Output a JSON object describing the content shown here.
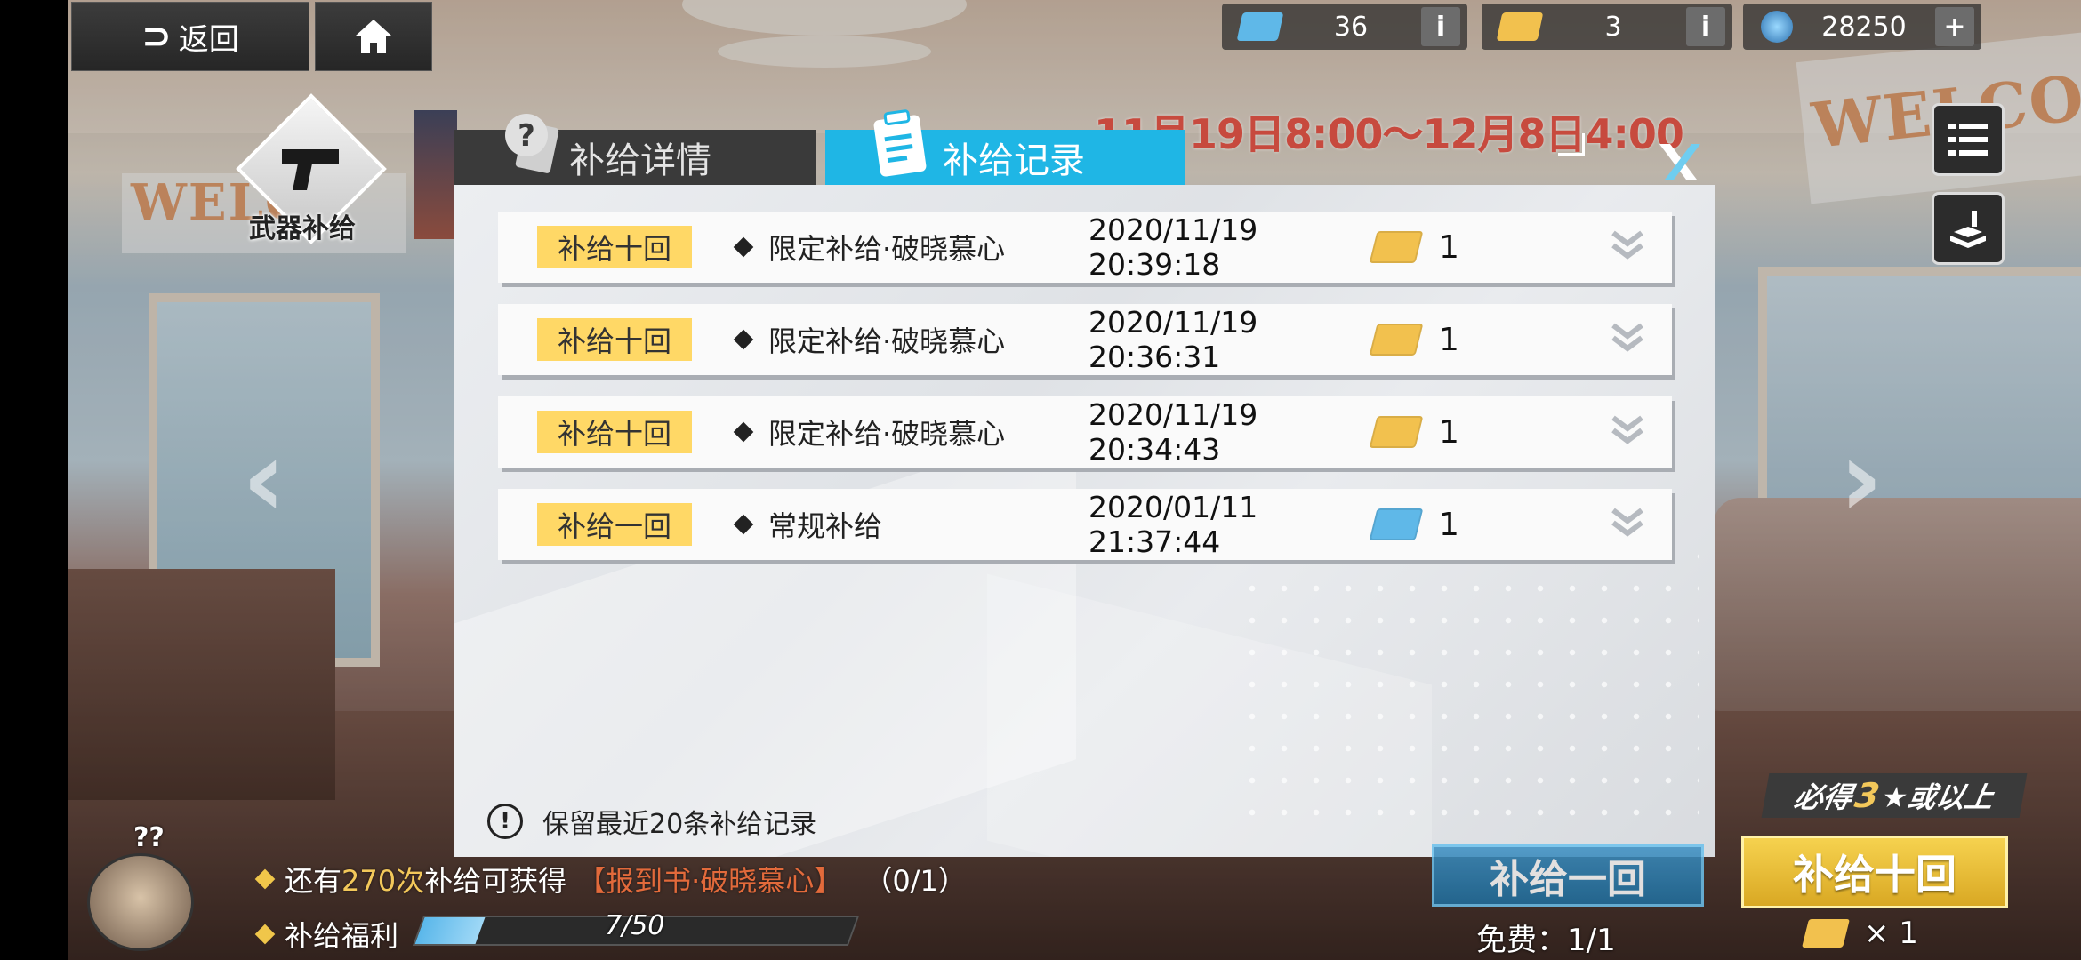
{
  "colors": {
    "accent_tab": "#1fb6e5",
    "tag_bg": "#ffd866",
    "date_red": "#c74a3e",
    "highlight": "#f3c85a",
    "ticket_gold": "#f2c14e",
    "ticket_blue": "#5fb8e8"
  },
  "topbar": {
    "back_label": "返回",
    "back_icon": "back-arrow-icon",
    "home_icon": "home-icon",
    "resources": [
      {
        "icon": "blue-ticket-icon",
        "value": "36",
        "button": "i"
      },
      {
        "icon": "gold-ticket-icon",
        "value": "3",
        "button": "i"
      },
      {
        "icon": "crystal-icon",
        "value": "28250",
        "button": "+"
      }
    ]
  },
  "emblem": {
    "label": "武器补给",
    "icon": "pistol-icon"
  },
  "date_range": "11月19日8:00～12月8日4:00",
  "modal": {
    "tabs": [
      {
        "label": "补给详情",
        "icon": "question-icon",
        "active": false
      },
      {
        "label": "补给记录",
        "icon": "clipboard-icon",
        "active": true
      }
    ],
    "close_icon": "close-icon",
    "records": [
      {
        "tag": "补给十回",
        "pool": "限定补给·破晓慕心",
        "time": "2020/11/19 20:39:18",
        "ticket": "gold",
        "qty": "1"
      },
      {
        "tag": "补给十回",
        "pool": "限定补给·破晓慕心",
        "time": "2020/11/19 20:36:31",
        "ticket": "gold",
        "qty": "1"
      },
      {
        "tag": "补给十回",
        "pool": "限定补给·破晓慕心",
        "time": "2020/11/19 20:34:43",
        "ticket": "gold",
        "qty": "1"
      },
      {
        "tag": "补给一回",
        "pool": "常规补给",
        "time": "2020/01/11 21:37:44",
        "ticket": "blue",
        "qty": "1"
      }
    ],
    "note": "保留最近20条补给记录"
  },
  "bottom": {
    "line1_prefix": "还有",
    "line1_count": "270次",
    "line1_mid": "补给可获得",
    "line1_item": "【报到书·破晓慕心】",
    "line1_progress": "（0/1）",
    "welfare_label": "补给福利",
    "welfare_progress": "7/50",
    "welfare_fraction": 0.14,
    "once_label": "补给一回",
    "free_text": "免费：1/1",
    "must_get_prefix": "必得",
    "must_get_num": "3",
    "must_get_suffix": "★或以上",
    "ten_label": "补给十回",
    "ten_cost": "× 1"
  },
  "side_buttons": [
    "menu-icon",
    "warehouse-icon"
  ]
}
